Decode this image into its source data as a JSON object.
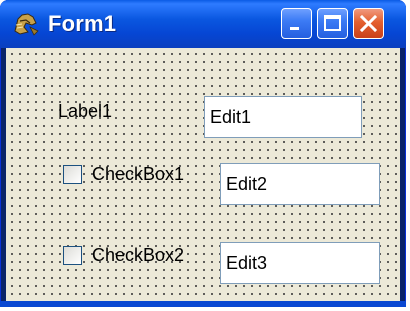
{
  "window": {
    "title": "Form1",
    "icon": "delphi-helmet-icon",
    "controls": {
      "minimize": "minimize-icon",
      "maximize": "maximize-icon",
      "close": "close-icon"
    }
  },
  "form": {
    "label1": "Label1",
    "edit1": "Edit1",
    "checkbox1": {
      "label": "CheckBox1",
      "checked": false
    },
    "edit2": "Edit2",
    "checkbox2": {
      "label": "CheckBox2",
      "checked": false
    },
    "edit3": "Edit3"
  },
  "colors": {
    "titlebar": "#0A57E0",
    "client": "#ECE9D8",
    "close_button": "#E4602F"
  }
}
